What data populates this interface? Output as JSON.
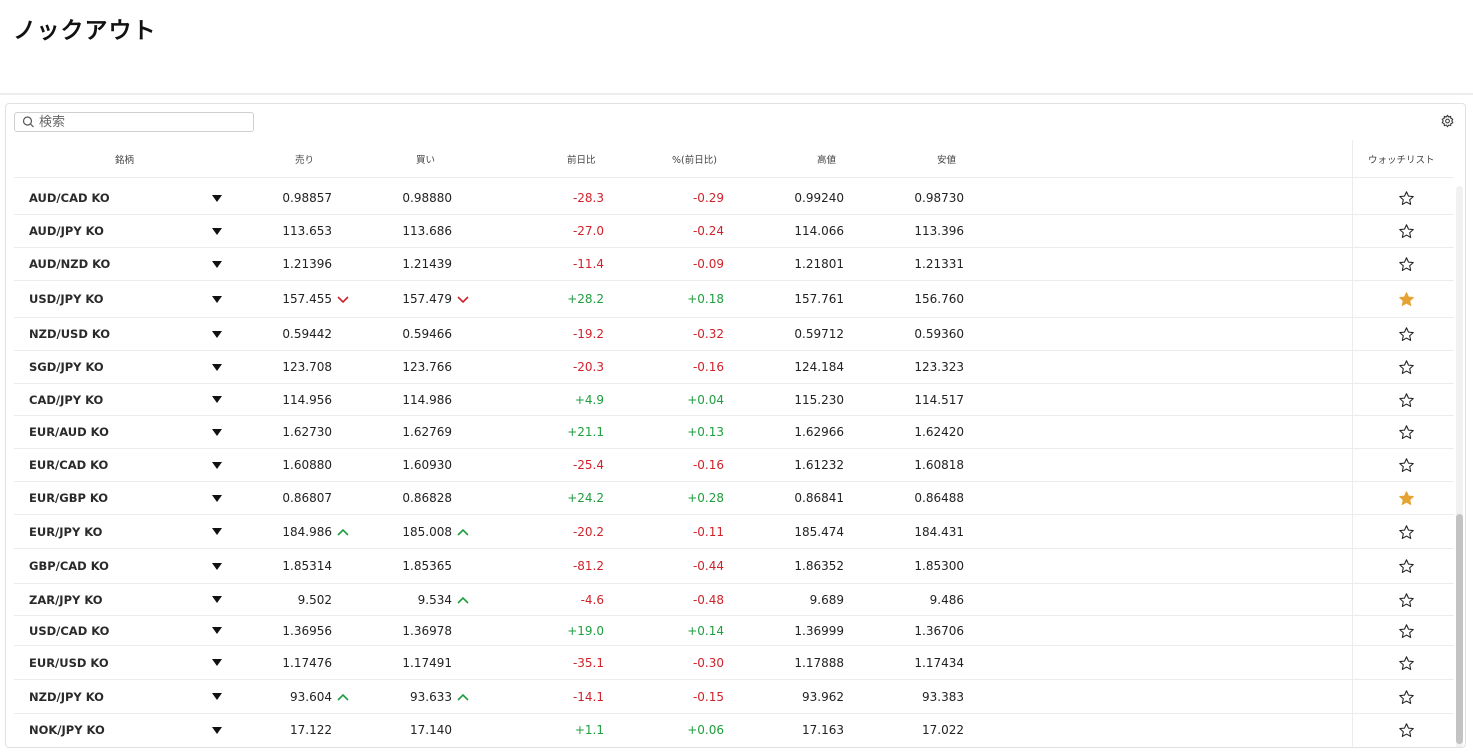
{
  "page": {
    "title": "ノックアウト"
  },
  "search": {
    "placeholder": "検索",
    "value": ""
  },
  "columns": {
    "name": "銘柄",
    "sell": "売り",
    "buy": "買い",
    "change": "前日比",
    "change_pct": "%(前日比)",
    "high": "高値",
    "low": "安値",
    "watchlist": "ウォッチリスト"
  },
  "colors": {
    "up": "#1e9e3e",
    "down": "#d0222a",
    "star_filled": "#e5a333",
    "neutral": "#222222"
  },
  "icons": {
    "search": "search-icon",
    "settings": "gear-icon",
    "expand": "caret-down-icon",
    "watch": "star-icon"
  },
  "rows": [
    {
      "name": "AUD/CAD KO",
      "sell": "0.98857",
      "sell_dir": "",
      "buy": "0.98880",
      "buy_dir": "",
      "change": "-28.3",
      "change_pct": "-0.29",
      "high": "0.99240",
      "low": "0.98730",
      "watch": false
    },
    {
      "name": "AUD/JPY KO",
      "sell": "113.653",
      "sell_dir": "",
      "buy": "113.686",
      "buy_dir": "",
      "change": "-27.0",
      "change_pct": "-0.24",
      "high": "114.066",
      "low": "113.396",
      "watch": false
    },
    {
      "name": "AUD/NZD KO",
      "sell": "1.21396",
      "sell_dir": "",
      "buy": "1.21439",
      "buy_dir": "",
      "change": "-11.4",
      "change_pct": "-0.09",
      "high": "1.21801",
      "low": "1.21331",
      "watch": false
    },
    {
      "name": "USD/JPY KO",
      "sell": "157.455",
      "sell_dir": "down",
      "buy": "157.479",
      "buy_dir": "down",
      "change": "+28.2",
      "change_pct": "+0.18",
      "high": "157.761",
      "low": "156.760",
      "watch": true
    },
    {
      "name": "NZD/USD KO",
      "sell": "0.59442",
      "sell_dir": "",
      "buy": "0.59466",
      "buy_dir": "",
      "change": "-19.2",
      "change_pct": "-0.32",
      "high": "0.59712",
      "low": "0.59360",
      "watch": false
    },
    {
      "name": "SGD/JPY KO",
      "sell": "123.708",
      "sell_dir": "",
      "buy": "123.766",
      "buy_dir": "",
      "change": "-20.3",
      "change_pct": "-0.16",
      "high": "124.184",
      "low": "123.323",
      "watch": false
    },
    {
      "name": "CAD/JPY KO",
      "sell": "114.956",
      "sell_dir": "",
      "buy": "114.986",
      "buy_dir": "",
      "change": "+4.9",
      "change_pct": "+0.04",
      "high": "115.230",
      "low": "114.517",
      "watch": false
    },
    {
      "name": "EUR/AUD KO",
      "sell": "1.62730",
      "sell_dir": "",
      "buy": "1.62769",
      "buy_dir": "",
      "change": "+21.1",
      "change_pct": "+0.13",
      "high": "1.62966",
      "low": "1.62420",
      "watch": false
    },
    {
      "name": "EUR/CAD KO",
      "sell": "1.60880",
      "sell_dir": "",
      "buy": "1.60930",
      "buy_dir": "",
      "change": "-25.4",
      "change_pct": "-0.16",
      "high": "1.61232",
      "low": "1.60818",
      "watch": false
    },
    {
      "name": "EUR/GBP KO",
      "sell": "0.86807",
      "sell_dir": "",
      "buy": "0.86828",
      "buy_dir": "",
      "change": "+24.2",
      "change_pct": "+0.28",
      "high": "0.86841",
      "low": "0.86488",
      "watch": true
    },
    {
      "name": "EUR/JPY KO",
      "sell": "184.986",
      "sell_dir": "up",
      "buy": "185.008",
      "buy_dir": "up",
      "change": "-20.2",
      "change_pct": "-0.11",
      "high": "185.474",
      "low": "184.431",
      "watch": false
    },
    {
      "name": "GBP/CAD KO",
      "sell": "1.85314",
      "sell_dir": "",
      "buy": "1.85365",
      "buy_dir": "",
      "change": "-81.2",
      "change_pct": "-0.44",
      "high": "1.86352",
      "low": "1.85300",
      "watch": false
    },
    {
      "name": "ZAR/JPY KO",
      "sell": "9.502",
      "sell_dir": "",
      "buy": "9.534",
      "buy_dir": "up",
      "change": "-4.6",
      "change_pct": "-0.48",
      "high": "9.689",
      "low": "9.486",
      "watch": false
    },
    {
      "name": "USD/CAD KO",
      "sell": "1.36956",
      "sell_dir": "",
      "buy": "1.36978",
      "buy_dir": "",
      "change": "+19.0",
      "change_pct": "+0.14",
      "high": "1.36999",
      "low": "1.36706",
      "watch": false
    },
    {
      "name": "EUR/USD KO",
      "sell": "1.17476",
      "sell_dir": "",
      "buy": "1.17491",
      "buy_dir": "",
      "change": "-35.1",
      "change_pct": "-0.30",
      "high": "1.17888",
      "low": "1.17434",
      "watch": false
    },
    {
      "name": "NZD/JPY KO",
      "sell": "93.604",
      "sell_dir": "up",
      "buy": "93.633",
      "buy_dir": "up",
      "change": "-14.1",
      "change_pct": "-0.15",
      "high": "93.962",
      "low": "93.383",
      "watch": false
    },
    {
      "name": "NOK/JPY KO",
      "sell": "17.122",
      "sell_dir": "",
      "buy": "17.140",
      "buy_dir": "",
      "change": "+1.1",
      "change_pct": "+0.06",
      "high": "17.163",
      "low": "17.022",
      "watch": false
    }
  ]
}
